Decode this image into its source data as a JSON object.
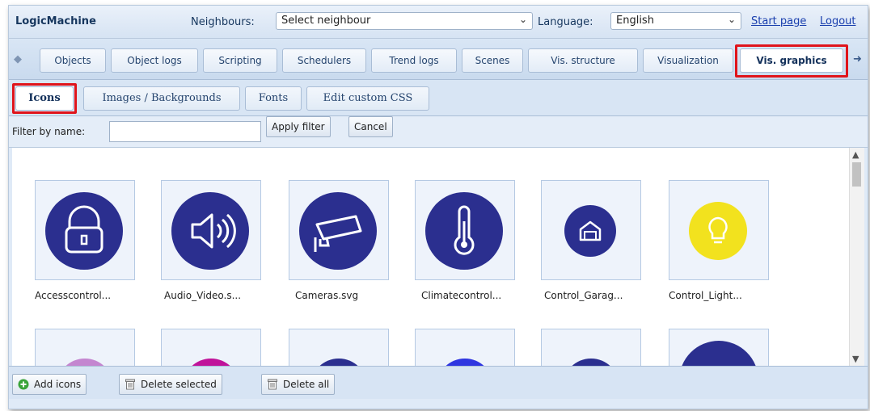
{
  "header": {
    "brand": "LogicMachine",
    "neighbours_label": "Neighbours:",
    "neighbours_value": "Select neighbour",
    "language_label": "Language:",
    "language_value": "English",
    "start_page": "Start page",
    "logout": "Logout"
  },
  "tabs": [
    "Objects",
    "Object logs",
    "Scripting",
    "Schedulers",
    "Trend logs",
    "Scenes",
    "Vis. structure",
    "Visualization",
    "Vis. graphics"
  ],
  "active_tab": "Vis. graphics",
  "subtabs": [
    "Icons",
    "Images / Backgrounds",
    "Fonts",
    "Edit custom CSS"
  ],
  "active_subtab": "Icons",
  "filter": {
    "label": "Filter by name:",
    "value": "",
    "apply": "Apply filter",
    "cancel": "Cancel"
  },
  "icons": [
    {
      "caption": "Accesscontrol...",
      "icon": "padlock-icon",
      "color": "#2b2f8f"
    },
    {
      "caption": "Audio_Video.s...",
      "icon": "speaker-icon",
      "color": "#2b2f8f"
    },
    {
      "caption": "Cameras.svg",
      "icon": "camera-icon",
      "color": "#2b2f8f"
    },
    {
      "caption": "Climatecontrol...",
      "icon": "thermometer-icon",
      "color": "#2b2f8f"
    },
    {
      "caption": "Control_Garag...",
      "icon": "garage-icon",
      "color": "#2b2f8f"
    },
    {
      "caption": "Control_Light...",
      "icon": "lightbulb-icon",
      "color": "#f2e21e"
    }
  ],
  "icons_row2_colors": [
    "#c486d0",
    "#c0139a",
    "#2b2f8f",
    "#2f36e0",
    "#2b2f8f",
    "#2b2f8f"
  ],
  "toolbar": {
    "add": "Add icons",
    "delete_selected": "Delete selected",
    "delete_all": "Delete all"
  },
  "colors": {
    "highlight": "#e0141b",
    "icon_primary": "#2b2f8f"
  }
}
